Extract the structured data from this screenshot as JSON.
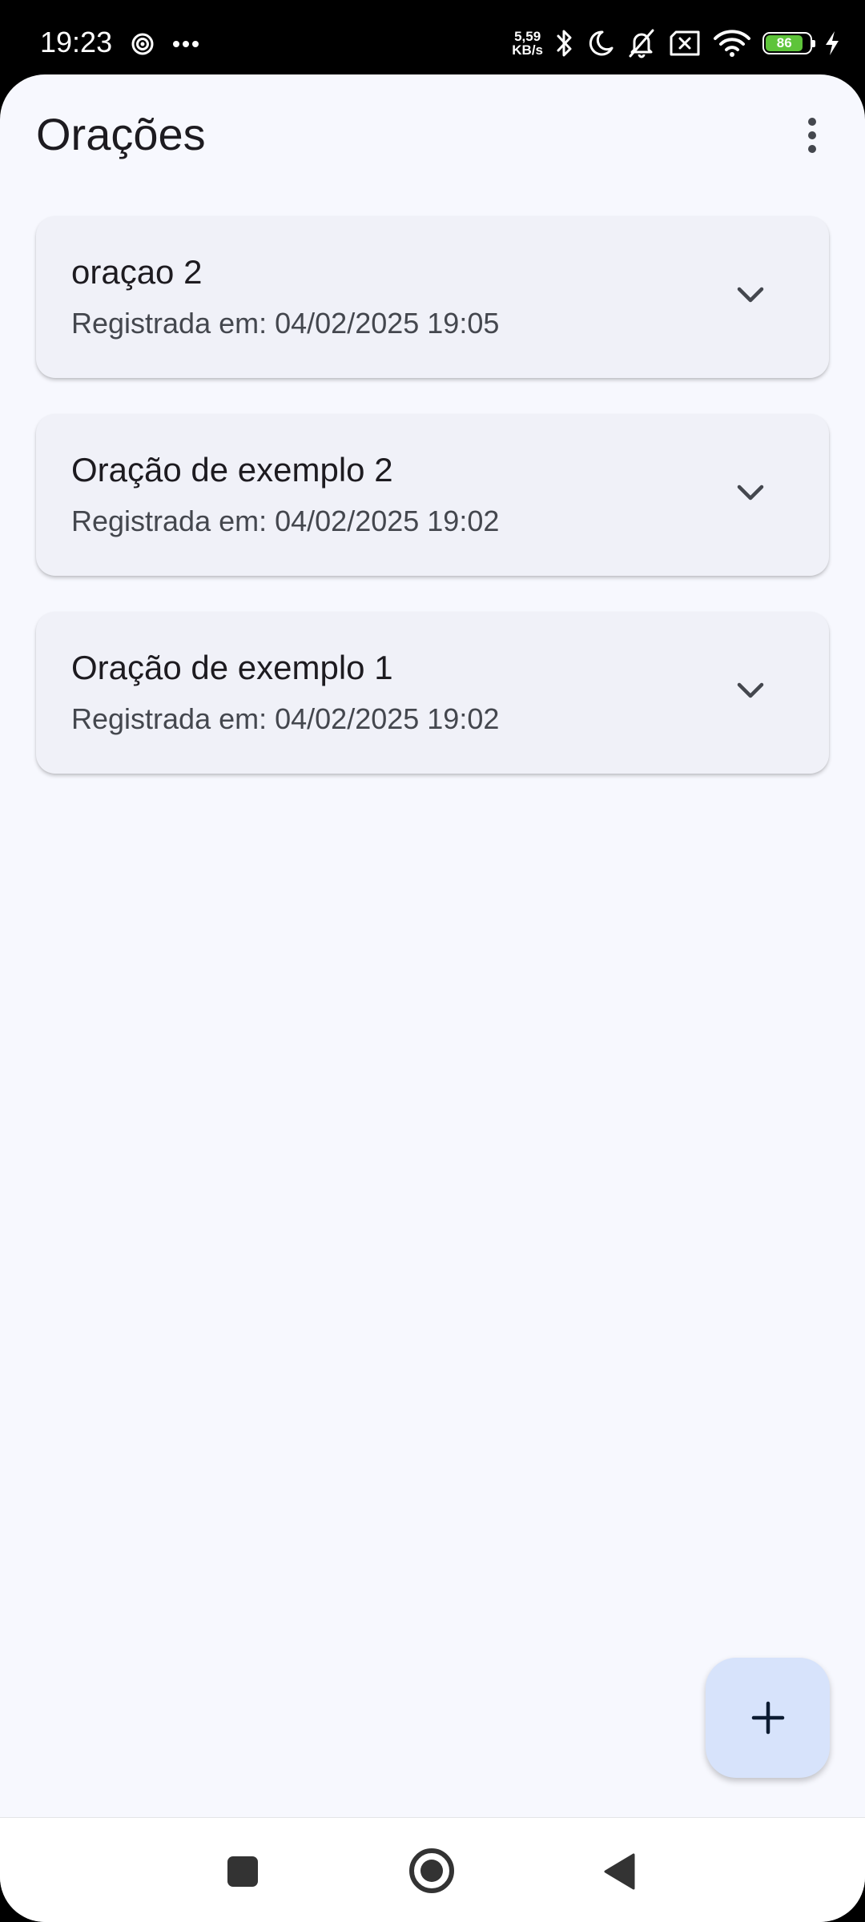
{
  "status_bar": {
    "time": "19:23",
    "net_speed_value": "5,59",
    "net_speed_unit": "KB/s",
    "battery_level": "86",
    "icons": [
      "hotspot-icon",
      "more-dots-icon",
      "bluetooth-icon",
      "moon-icon",
      "bell-off-icon",
      "sim-x-icon",
      "wifi-icon",
      "battery-icon",
      "charging-icon"
    ]
  },
  "app_bar": {
    "title": "Orações",
    "menu_icon": "more-vert-icon"
  },
  "prayers": [
    {
      "title": "oraçao 2",
      "date": "Registrada em: 04/02/2025 19:05"
    },
    {
      "title": "Oração de exemplo 2",
      "date": "Registrada em: 04/02/2025 19:02"
    },
    {
      "title": "Oração de exemplo 1",
      "date": "Registrada em: 04/02/2025 19:02"
    }
  ],
  "fab": {
    "icon": "add-icon"
  },
  "navigation": {
    "icons": [
      "recents-square-icon",
      "home-circle-icon",
      "back-triangle-icon"
    ]
  },
  "colors": {
    "background": "#f7f8fe",
    "card": "#f0f1f8",
    "fab": "#d7e3fb",
    "battery_fill": "#5ec43a"
  }
}
